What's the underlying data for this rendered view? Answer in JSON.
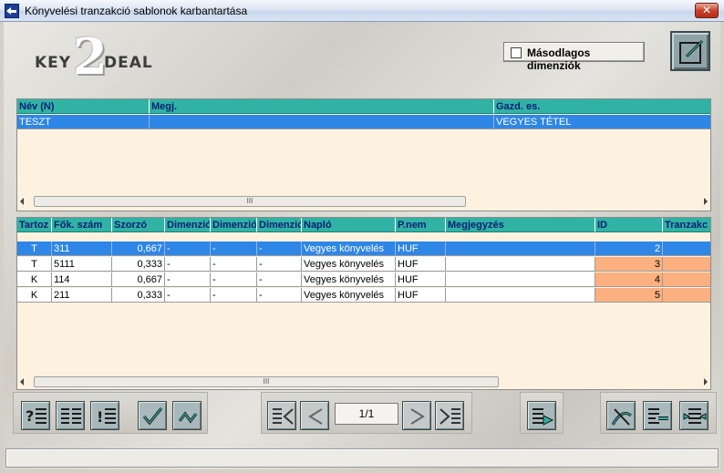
{
  "window": {
    "title": "Könyvelési tranzakció sablonok karbantartása",
    "close_label": "✕"
  },
  "logo": {
    "key": "KEY",
    "two": "2",
    "deal": "DEAL"
  },
  "dim_toggle": {
    "label": "Másodlagos dimenziók",
    "checked": false
  },
  "grid1": {
    "headers": [
      "Név (N)",
      "Megj.",
      "Gazd. es."
    ],
    "rows": [
      {
        "nev": "TESZT",
        "megj": "",
        "gazd": "VEGYES TÉTEL"
      }
    ],
    "scroll_thumb": "III"
  },
  "grid2": {
    "headers": [
      "Tartoz",
      "Fők. szám",
      "Szorzó",
      "Dimenzió",
      "Dimenzió",
      "Dimenzió",
      "Napló",
      "P.nem",
      "Megjegyzés",
      "ID",
      "Tranzakc"
    ],
    "rows": [
      {
        "tartoz": "T",
        "fok": "311",
        "szorzo": "0,667",
        "d1": "-",
        "d2": "-",
        "d3": "-",
        "naplo": "Vegyes könyvelés",
        "pnem": "HUF",
        "megj": "",
        "id": "2",
        "tr": ""
      },
      {
        "tartoz": "T",
        "fok": "5111",
        "szorzo": "0,333",
        "d1": "-",
        "d2": "-",
        "d3": "-",
        "naplo": "Vegyes könyvelés",
        "pnem": "HUF",
        "megj": "",
        "id": "3",
        "tr": ""
      },
      {
        "tartoz": "K",
        "fok": "114",
        "szorzo": "0,667",
        "d1": "-",
        "d2": "-",
        "d3": "-",
        "naplo": "Vegyes könyvelés",
        "pnem": "HUF",
        "megj": "",
        "id": "4",
        "tr": ""
      },
      {
        "tartoz": "K",
        "fok": "211",
        "szorzo": "0,333",
        "d1": "-",
        "d2": "-",
        "d3": "-",
        "naplo": "Vegyes könyvelés",
        "pnem": "HUF",
        "megj": "",
        "id": "5",
        "tr": ""
      }
    ],
    "scroll_thumb": "III"
  },
  "pager": {
    "text": "1/1"
  },
  "colors": {
    "header": "#30b3a5",
    "header_text": "#0a1e73",
    "selection": "#2e86e6",
    "grid_bg": "#fdf2e0",
    "id_highlight": "#fcb07f"
  }
}
